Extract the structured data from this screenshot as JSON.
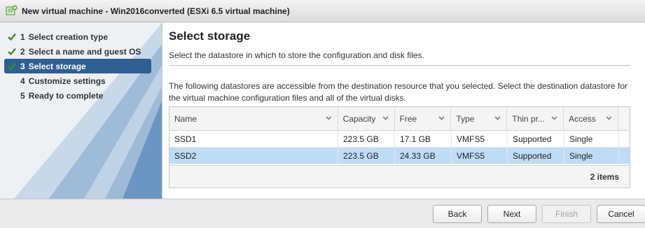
{
  "window": {
    "title": "New virtual machine - Win2016converted (ESXi 6.5 virtual machine)",
    "icon": "new-vm-icon"
  },
  "wizard": {
    "steps": [
      {
        "number": "1",
        "label": "Select creation type",
        "state": "done"
      },
      {
        "number": "2",
        "label": "Select a name and guest OS",
        "state": "done"
      },
      {
        "number": "3",
        "label": "Select storage",
        "state": "active"
      },
      {
        "number": "4",
        "label": "Customize settings",
        "state": "pending"
      },
      {
        "number": "5",
        "label": "Ready to complete",
        "state": "pending"
      }
    ]
  },
  "content": {
    "heading": "Select storage",
    "subheading": "Select the datastore in which to store the configuration and disk files.",
    "description": "The following datastores are accessible from the destination resource that you selected. Select the destination datastore for the virtual machine configuration files and all of the virtual disks."
  },
  "grid": {
    "columns": [
      "Name",
      "Capacity",
      "Free",
      "Type",
      "Thin pr...",
      "Access"
    ],
    "rows": [
      {
        "name": "SSD1",
        "capacity": "223.5 GB",
        "free": "17.1 GB",
        "type": "VMFS5",
        "thin": "Supported",
        "access": "Single",
        "selected": false
      },
      {
        "name": "SSD2",
        "capacity": "223.5 GB",
        "free": "24.33 GB",
        "type": "VMFS5",
        "thin": "Supported",
        "access": "Single",
        "selected": true
      }
    ],
    "item_count": "2 items"
  },
  "buttons": {
    "back": "Back",
    "next": "Next",
    "finish": "Finish",
    "cancel": "Cancel",
    "finish_disabled": true
  },
  "colors": {
    "active_step_bg": "#2f5f93",
    "selected_row_bg": "#bfdcf7",
    "check_green": "#3a8f2a"
  }
}
